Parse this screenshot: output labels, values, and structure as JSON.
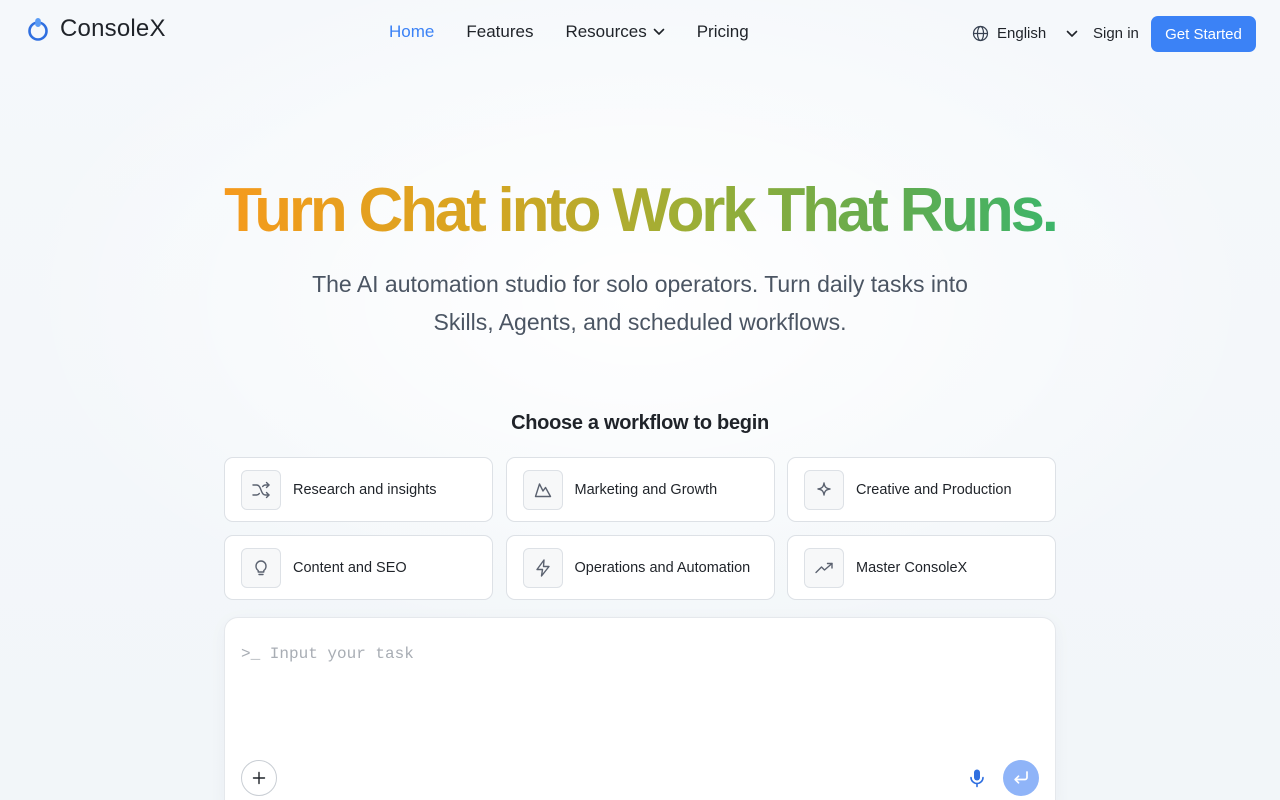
{
  "brand": {
    "name": "ConsoleX",
    "accent": "#3b82f6"
  },
  "nav": {
    "items": [
      {
        "label": "Home",
        "active": true
      },
      {
        "label": "Features",
        "active": false
      },
      {
        "label": "Resources",
        "active": false,
        "dropdown": true
      },
      {
        "label": "Pricing",
        "active": false
      }
    ]
  },
  "header": {
    "language": "English",
    "sign_in": "Sign in",
    "get_started": "Get Started"
  },
  "hero": {
    "headline": "Turn Chat into Work That Runs.",
    "subhead": "The AI automation studio for solo operators. Turn daily tasks into Skills, Agents, and scheduled workflows."
  },
  "workflows": {
    "heading": "Choose a workflow to begin",
    "items": [
      {
        "label": "Research and insights",
        "icon": "shuffle-icon"
      },
      {
        "label": "Marketing and Growth",
        "icon": "mountain-icon"
      },
      {
        "label": "Creative and Production",
        "icon": "sparkle-icon"
      },
      {
        "label": "Content and SEO",
        "icon": "lightbulb-icon"
      },
      {
        "label": "Operations and Automation",
        "icon": "lightning-icon"
      },
      {
        "label": "Master ConsoleX",
        "icon": "trending-up-icon"
      }
    ]
  },
  "task": {
    "placeholder": ">_ Input your task",
    "value": ""
  }
}
